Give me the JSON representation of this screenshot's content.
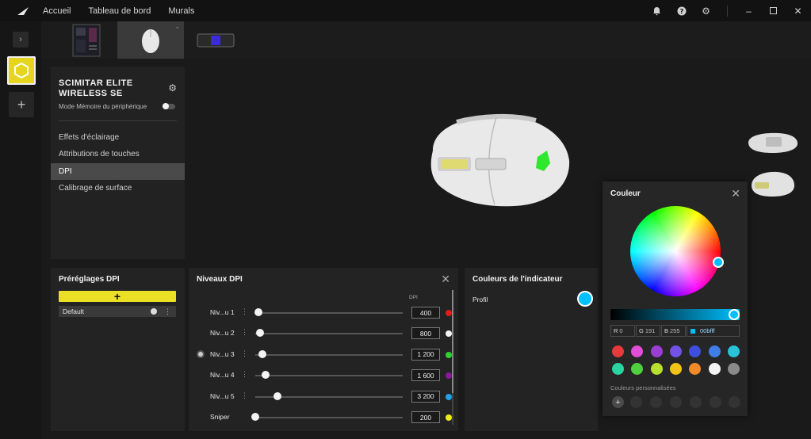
{
  "nav": {
    "links": [
      "Accueil",
      "Tableau de bord",
      "Murals"
    ]
  },
  "window_icons": [
    "bell-icon",
    "help-icon",
    "gear-icon",
    "minimize-icon",
    "maximize-icon",
    "close-icon"
  ],
  "device": {
    "name": "SCIMITAR ELITE WIRELESS SE",
    "memory_mode_label": "Mode Mémoire du périphérique",
    "menu": [
      "Effets d'éclairage",
      "Attributions de touches",
      "DPI",
      "Calibrage de surface"
    ],
    "active_menu": "DPI"
  },
  "presets": {
    "title": "Préréglages DPI",
    "add_label": "+",
    "items": [
      "Default"
    ]
  },
  "levels": {
    "title": "Niveaux DPI",
    "column_label": "DPI",
    "rows": [
      {
        "label": "Niv...u 1",
        "value": "400",
        "color": "#e21b1b",
        "fill": 0.02
      },
      {
        "label": "Niv...u 2",
        "value": "800",
        "color": "#f2f2f2",
        "fill": 0.03
      },
      {
        "label": "Niv...u 3",
        "value": "1 200",
        "color": "#2bd42b",
        "fill": 0.05,
        "active": true
      },
      {
        "label": "Niv...u 4",
        "value": "1 600",
        "color": "#8a1a9a",
        "fill": 0.07
      },
      {
        "label": "Niv...u 5",
        "value": "3 200",
        "color": "#1ea3e8",
        "fill": 0.15
      },
      {
        "label": "Sniper",
        "value": "200",
        "color": "#ecec1a",
        "fill": 0.0
      }
    ]
  },
  "indicator": {
    "title": "Couleurs de l'indicateur",
    "profile_label": "Profil",
    "color": "#00bfff"
  },
  "color_picker": {
    "title": "Couleur",
    "r_label": "R",
    "r": "0",
    "g_label": "G",
    "g": "191",
    "b_label": "B",
    "b": "255",
    "hex": "00bfff",
    "swatches": [
      "#e83a3a",
      "#e04fd6",
      "#9b3fd4",
      "#7352e8",
      "#3e4fe0",
      "#3f7ee8",
      "#29c3d8",
      "#2ad4a0",
      "#4fd03f",
      "#b8e02f",
      "#f2c418",
      "#f28a2a",
      "#f4f4f4",
      "#8a8a8a"
    ],
    "custom_label": "Couleurs personnalisées",
    "custom_add": "+"
  }
}
